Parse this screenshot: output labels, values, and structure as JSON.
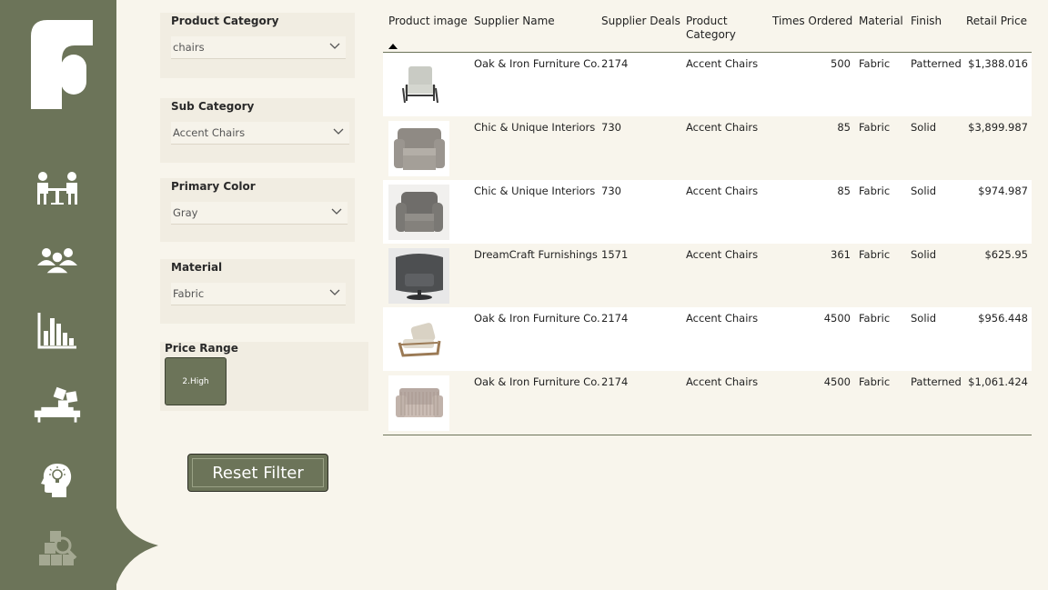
{
  "colors": {
    "sidebar": "#6c7459",
    "background": "#f8f5ec",
    "slicer_bg": "#f1ede2",
    "row_alt": "#ffffff"
  },
  "sidebar": {
    "logo": "brand-logo",
    "nav_items": [
      {
        "icon": "meeting-icon"
      },
      {
        "icon": "team-icon"
      },
      {
        "icon": "bar-chart-icon"
      },
      {
        "icon": "sofa-puzzle-icon"
      },
      {
        "icon": "idea-head-icon"
      },
      {
        "icon": "inventory-search-icon"
      }
    ]
  },
  "filters": {
    "product_category": {
      "label": "Product Category",
      "value": "chairs"
    },
    "sub_category": {
      "label": "Sub Category",
      "value": "Accent Chairs"
    },
    "primary_color": {
      "label": "Primary Color",
      "value": "Gray"
    },
    "material": {
      "label": "Material",
      "value": "Fabric"
    },
    "price_range": {
      "label": "Price Range",
      "tile": "2.High"
    }
  },
  "reset_button": {
    "label": "Reset Filter"
  },
  "table": {
    "headers": {
      "image": "Product image",
      "supplier": "Supplier Name",
      "deals": "Supplier Deals",
      "category_1": "Product",
      "category_2": "Category",
      "ordered": "Times Ordered",
      "material": "Material",
      "finish": "Finish",
      "price": "Retail Price"
    },
    "rows": [
      {
        "supplier": "Oak & Iron Furniture Co.",
        "deals": "2174",
        "category": "Accent Chairs",
        "ordered": "500",
        "material": "Fabric",
        "finish": "Patterned",
        "price": "$1,388.016",
        "image": "light-gray-armchair-wood-frame"
      },
      {
        "supplier": "Chic & Unique Interiors",
        "deals": "730",
        "category": "Accent Chairs",
        "ordered": "85",
        "material": "Fabric",
        "finish": "Solid",
        "price": "$3,899.987",
        "image": "gray-slipcover-armchair"
      },
      {
        "supplier": "Chic & Unique Interiors",
        "deals": "730",
        "category": "Accent Chairs",
        "ordered": "85",
        "material": "Fabric",
        "finish": "Solid",
        "price": "$974.987",
        "image": "gray-upholstered-armchair"
      },
      {
        "supplier": "DreamCraft Furnishings",
        "deals": "1571",
        "category": "Accent Chairs",
        "ordered": "361",
        "material": "Fabric",
        "finish": "Solid",
        "price": "$625.95",
        "image": "charcoal-swivel-barrel-chair"
      },
      {
        "supplier": "Oak & Iron Furniture Co.",
        "deals": "2174",
        "category": "Accent Chairs",
        "ordered": "4500",
        "material": "Fabric",
        "finish": "Solid",
        "price": "$956.448",
        "image": "wood-frame-lounge-chair"
      },
      {
        "supplier": "Oak & Iron Furniture Co.",
        "deals": "2174",
        "category": "Accent Chairs",
        "ordered": "4500",
        "material": "Fabric",
        "finish": "Patterned",
        "price": "$1,061.424",
        "image": "striped-club-chair"
      }
    ]
  }
}
